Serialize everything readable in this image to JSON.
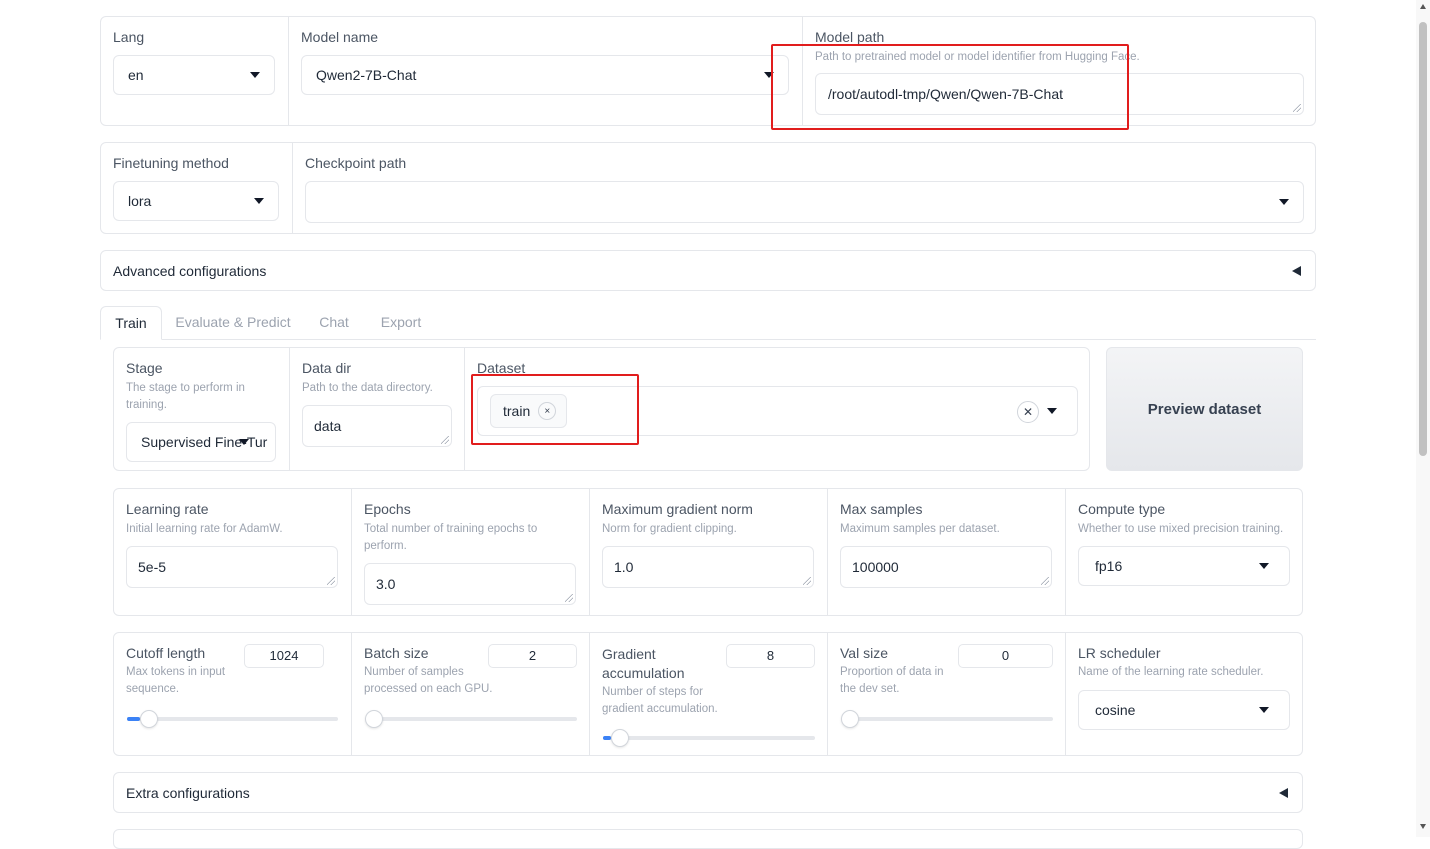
{
  "top": {
    "lang": {
      "label": "Lang",
      "value": "en"
    },
    "model_name": {
      "label": "Model name",
      "value": "Qwen2-7B-Chat"
    },
    "model_path": {
      "label": "Model path",
      "info": "Path to pretrained model or model identifier from Hugging Face.",
      "value": "/root/autodl-tmp/Qwen/Qwen-7B-Chat"
    }
  },
  "method_row": {
    "finetuning": {
      "label": "Finetuning method",
      "value": "lora"
    },
    "checkpoint": {
      "label": "Checkpoint path",
      "value": ""
    }
  },
  "advanced": {
    "label": "Advanced configurations"
  },
  "tabs": [
    {
      "label": "Train",
      "active": true
    },
    {
      "label": "Evaluate & Predict",
      "active": false
    },
    {
      "label": "Chat",
      "active": false
    },
    {
      "label": "Export",
      "active": false
    }
  ],
  "train": {
    "stage": {
      "label": "Stage",
      "info": "The stage to perform in training.",
      "value": "Supervised Fine-Tur"
    },
    "data_dir": {
      "label": "Data dir",
      "info": "Path to the data directory.",
      "value": "data"
    },
    "dataset": {
      "label": "Dataset",
      "chip": "train",
      "chip_remove": "×",
      "clear": "✕"
    },
    "preview_button": "Preview dataset",
    "learning_rate": {
      "label": "Learning rate",
      "info": "Initial learning rate for AdamW.",
      "value": "5e-5"
    },
    "epochs": {
      "label": "Epochs",
      "info": "Total number of training epochs to perform.",
      "value": "3.0"
    },
    "max_grad_norm": {
      "label": "Maximum gradient norm",
      "info": "Norm for gradient clipping.",
      "value": "1.0"
    },
    "max_samples": {
      "label": "Max samples",
      "info": "Maximum samples per dataset.",
      "value": "100000"
    },
    "compute_type": {
      "label": "Compute type",
      "info": "Whether to use mixed precision training.",
      "value": "fp16"
    },
    "cutoff_length": {
      "label": "Cutoff length",
      "info": "Max tokens in input sequence.",
      "value": "1024",
      "fraction": 0.06
    },
    "batch_size": {
      "label": "Batch size",
      "info": "Number of samples processed on each GPU.",
      "value": "2",
      "fraction": 0.0
    },
    "grad_accum": {
      "label": "Gradient accumulation",
      "info": "Number of steps for gradient accumulation.",
      "value": "8",
      "fraction": 0.04
    },
    "val_size": {
      "label": "Val size",
      "info": "Proportion of data in the dev set.",
      "value": "0",
      "fraction": 0.0
    },
    "lr_scheduler": {
      "label": "LR scheduler",
      "info": "Name of the learning rate scheduler.",
      "value": "cosine"
    }
  },
  "extra": {
    "label": "Extra configurations"
  },
  "colors": {
    "highlight": "#e11d1d",
    "accent": "#3b82f6"
  }
}
